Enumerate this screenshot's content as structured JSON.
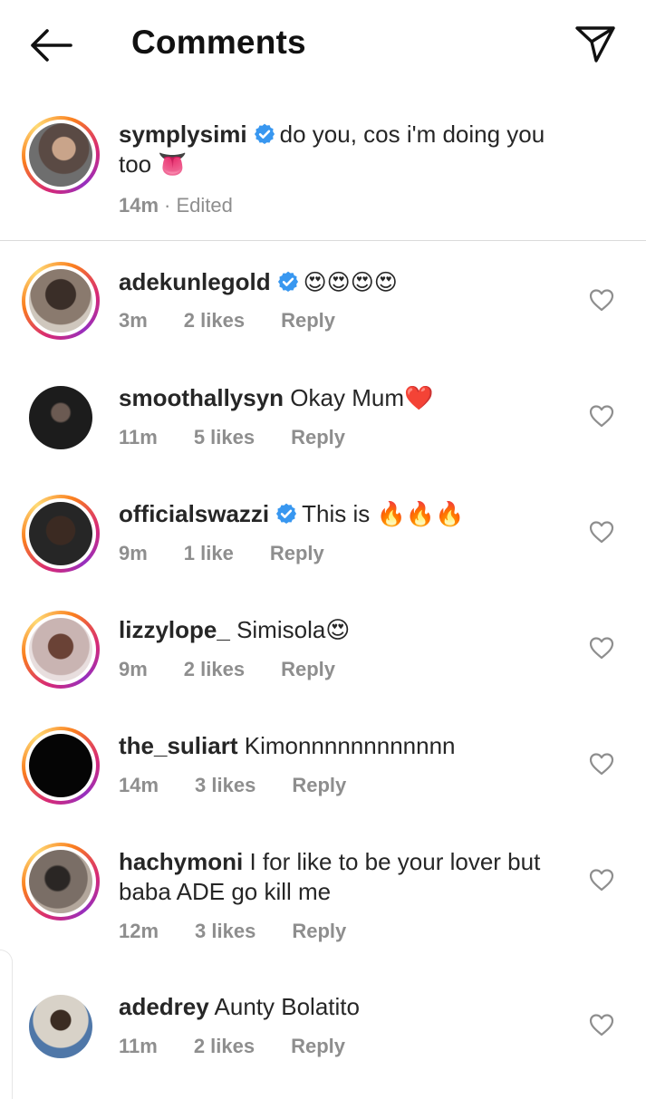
{
  "header": {
    "title": "Comments"
  },
  "caption": {
    "username": "symplysimi",
    "verified": true,
    "text": "do you, cos i'm doing you too 👅",
    "time": "14m",
    "edited": "· Edited"
  },
  "comments": [
    {
      "username": "adekunlegold",
      "verified": true,
      "text": "😍😍😍😍",
      "time": "3m",
      "likes": "2 likes",
      "reply": "Reply"
    },
    {
      "username": "smoothallysyn",
      "verified": false,
      "text": "Okay Mum❤️",
      "time": "11m",
      "likes": "5 likes",
      "reply": "Reply"
    },
    {
      "username": "officialswazzi",
      "verified": true,
      "text": "This is 🔥🔥🔥",
      "time": "9m",
      "likes": "1 like",
      "reply": "Reply"
    },
    {
      "username": "lizzylope_",
      "verified": false,
      "text": "Simisola😍",
      "time": "9m",
      "likes": "2 likes",
      "reply": "Reply"
    },
    {
      "username": "the_suliart",
      "verified": false,
      "text": "Kimonnnnnnnnnnnn",
      "time": "14m",
      "likes": "3 likes",
      "reply": "Reply"
    },
    {
      "username": "hachymoni",
      "verified": false,
      "text": "I for like to be your lover but baba ADE go kill me",
      "time": "12m",
      "likes": "3 likes",
      "reply": "Reply"
    },
    {
      "username": "adedrey",
      "verified": false,
      "text": "Aunty Bolatito",
      "time": "11m",
      "likes": "2 likes",
      "reply": "Reply"
    }
  ],
  "colors": {
    "verified": "#3897f0",
    "meta": "#8e8e8e",
    "ring_start": "#d62976",
    "ring_end": "#feda75"
  }
}
